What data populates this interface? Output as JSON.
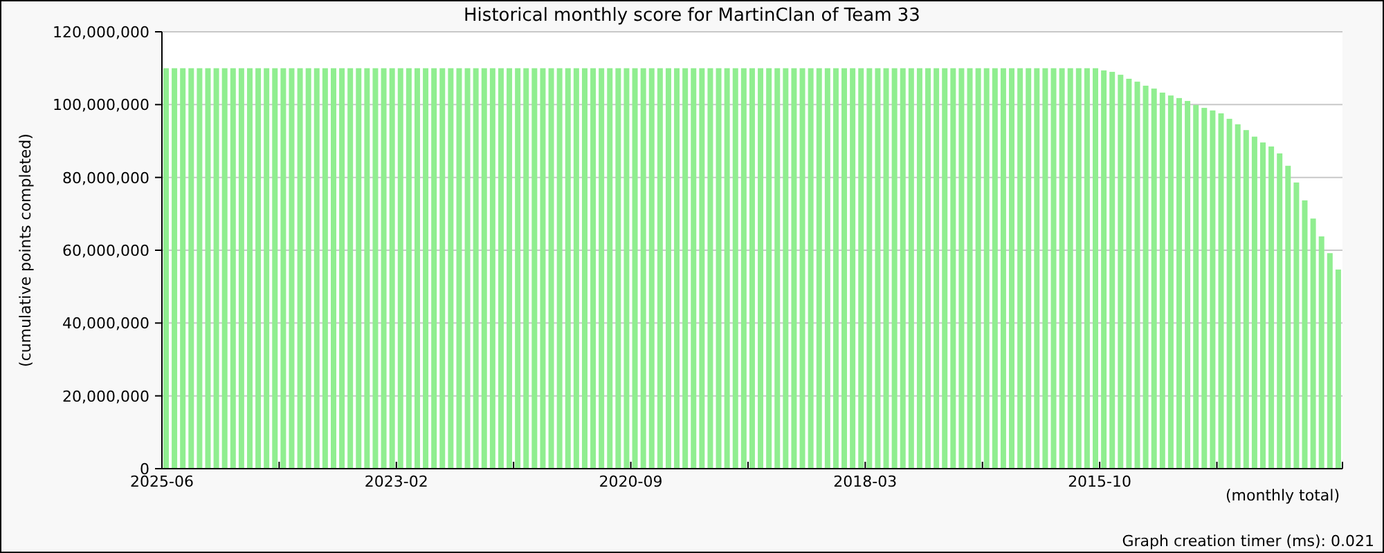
{
  "chart": {
    "chart_data": {
      "type": "bar",
      "title": "Historical monthly score for MartinClan of Team 33",
      "ylabel": "(cumulative points completed)",
      "xlabel": "(monthly total)",
      "color": "#90ee90",
      "values": [
        110000000,
        110000000,
        110000000,
        110000000,
        110000000,
        110000000,
        110000000,
        110000000,
        110000000,
        110000000,
        110000000,
        110000000,
        110000000,
        110000000,
        110000000,
        110000000,
        110000000,
        110000000,
        110000000,
        110000000,
        110000000,
        110000000,
        110000000,
        110000000,
        110000000,
        110000000,
        110000000,
        110000000,
        110000000,
        110000000,
        110000000,
        110000000,
        110000000,
        110000000,
        110000000,
        110000000,
        110000000,
        110000000,
        110000000,
        110000000,
        110000000,
        110000000,
        110000000,
        110000000,
        110000000,
        110000000,
        110000000,
        110000000,
        110000000,
        110000000,
        110000000,
        110000000,
        110000000,
        110000000,
        110000000,
        110000000,
        110000000,
        110000000,
        110000000,
        110000000,
        110000000,
        110000000,
        110000000,
        110000000,
        110000000,
        110000000,
        110000000,
        110000000,
        110000000,
        110000000,
        110000000,
        110000000,
        110000000,
        110000000,
        110000000,
        110000000,
        110000000,
        110000000,
        110000000,
        110000000,
        110000000,
        110000000,
        110000000,
        110000000,
        110000000,
        110000000,
        110000000,
        110000000,
        110000000,
        110000000,
        110000000,
        110000000,
        110000000,
        110000000,
        110000000,
        110000000,
        110000000,
        110000000,
        110000000,
        110000000,
        110000000,
        110000000,
        110000000,
        110000000,
        110000000,
        110000000,
        110000000,
        110000000,
        110000000,
        110000000,
        110000000,
        110000000,
        109400000,
        109000000,
        108200000,
        107100000,
        106300000,
        105200000,
        104400000,
        103300000,
        102500000,
        101800000,
        101000000,
        99900000,
        99100000,
        98400000,
        97600000,
        96100000,
        94600000,
        93000000,
        91200000,
        89600000,
        88500000,
        86600000,
        83200000,
        78600000,
        73700000,
        68700000,
        63800000,
        59200000,
        54700000
      ],
      "categories": [
        "2025-06",
        null,
        null,
        null,
        null,
        null,
        null,
        null,
        null,
        null,
        null,
        null,
        null,
        null,
        null,
        null,
        null,
        null,
        null,
        null,
        null,
        null,
        null,
        null,
        null,
        null,
        null,
        null,
        "2023-02",
        null,
        null,
        null,
        null,
        null,
        null,
        null,
        null,
        null,
        null,
        null,
        null,
        null,
        null,
        null,
        null,
        null,
        null,
        null,
        null,
        null,
        null,
        null,
        null,
        null,
        null,
        null,
        "2020-09",
        null,
        null,
        null,
        null,
        null,
        null,
        null,
        null,
        null,
        null,
        null,
        null,
        null,
        null,
        null,
        null,
        null,
        null,
        null,
        null,
        null,
        null,
        null,
        null,
        null,
        null,
        null,
        "2018-03",
        null,
        null,
        null,
        null,
        null,
        null,
        null,
        null,
        null,
        null,
        null,
        null,
        null,
        null,
        null,
        null,
        null,
        null,
        null,
        null,
        null,
        null,
        null,
        null,
        null,
        null,
        null,
        "2015-10",
        null,
        null,
        null,
        null,
        null,
        null,
        null,
        null,
        null,
        null,
        null,
        null,
        null,
        null,
        null,
        null,
        null,
        null,
        null,
        null,
        null,
        null,
        null,
        null,
        null,
        null,
        null,
        null
      ],
      "ylim": [
        0,
        120000000
      ],
      "grid": true,
      "yticks": [
        {
          "value": 0,
          "label": "0"
        },
        {
          "value": 20000000,
          "label": "20,000,000"
        },
        {
          "value": 40000000,
          "label": "40,000,000"
        },
        {
          "value": 60000000,
          "label": "60,000,000"
        },
        {
          "value": 80000000,
          "label": "80,000,000"
        },
        {
          "value": 100000000,
          "label": "100,000,000"
        },
        {
          "value": 120000000,
          "label": "120,000,000"
        }
      ]
    }
  },
  "footer": {
    "timer": "Graph creation timer (ms): 0.021"
  }
}
